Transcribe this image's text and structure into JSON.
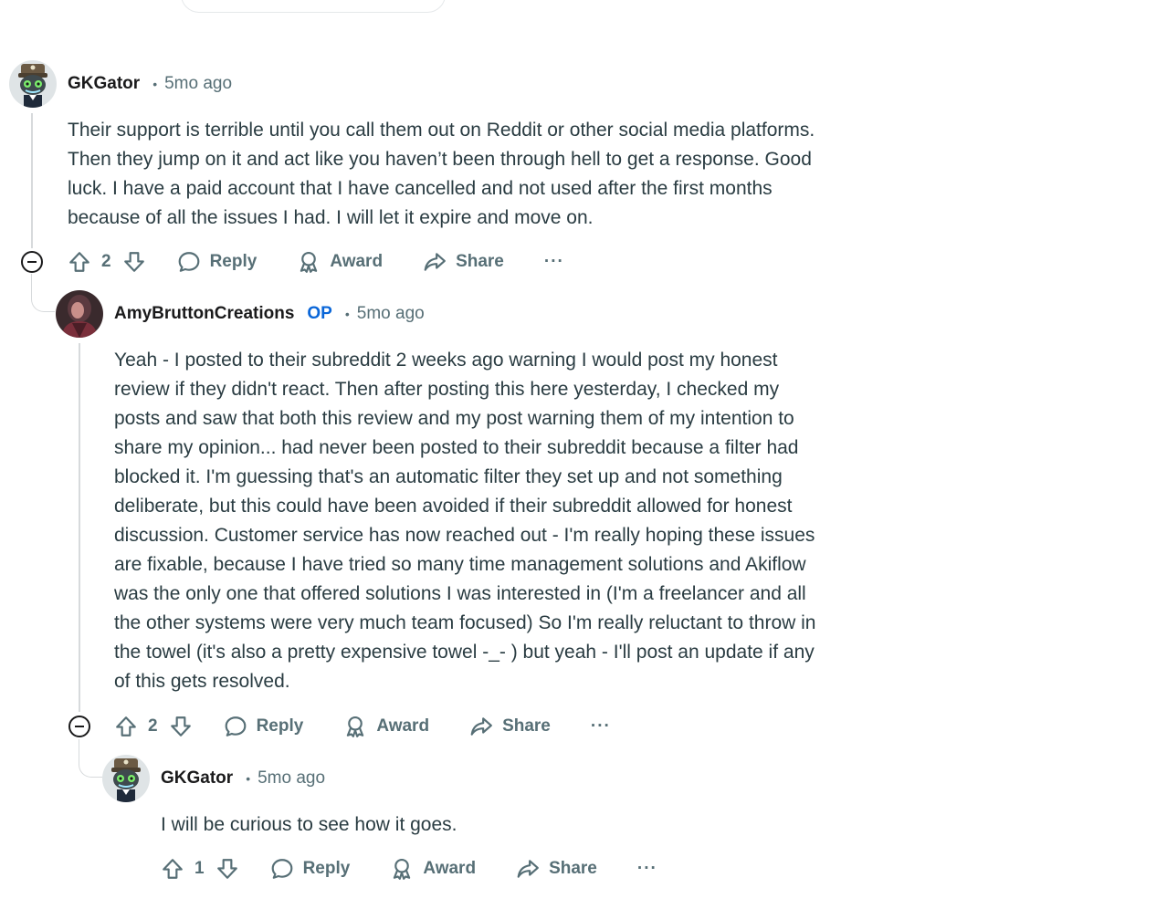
{
  "comments": [
    {
      "author": "GKGator",
      "op": "",
      "separator": "•",
      "time": "5mo ago",
      "body": "Their support is terrible until you call them out on Reddit or other social media platforms.\nThen they jump on it and act like you haven’t been through hell to get a response. Good\nluck. I have a paid account that I have cancelled and not used after the first months\nbecause of all the issues I had. I will let it expire and move on.",
      "votes": "2",
      "reply": "Reply",
      "award": "Award",
      "share": "Share",
      "more": "···"
    },
    {
      "author": "AmyBruttonCreations",
      "op": "OP",
      "separator": "•",
      "time": "5mo ago",
      "body": "Yeah - I posted to their subreddit 2 weeks ago warning I would post my honest\nreview if they didn't react. Then after posting this here yesterday, I checked my\nposts and saw that both this review and my post warning them of my intention to\nshare my opinion... had never been posted to their subreddit because a filter had\nblocked it. I'm guessing that's an automatic filter they set up and not something\ndeliberate, but this could have been avoided if their subreddit allowed for honest\ndiscussion. Customer service has now reached out - I'm really hoping these issues\nare fixable, because I have tried so many time management solutions and Akiflow\nwas the only one that offered solutions I was interested in (I'm a freelancer and all\nthe other systems were very much team focused) So I'm really reluctant to throw in\nthe towel (it's also a pretty expensive towel -_- ) but yeah - I'll post an update if any\nof this gets resolved.",
      "votes": "2",
      "reply": "Reply",
      "award": "Award",
      "share": "Share",
      "more": "···"
    },
    {
      "author": "GKGator",
      "op": "",
      "separator": "•",
      "time": "5mo ago",
      "body": "I will be curious to see how it goes.",
      "votes": "1",
      "reply": "Reply",
      "award": "Award",
      "share": "Share",
      "more": "···"
    }
  ],
  "icons": {
    "upvote": "upvote-arrow-icon",
    "downvote": "downvote-arrow-icon",
    "reply": "speech-bubble-icon",
    "award": "award-ribbon-icon",
    "share": "share-arrow-icon",
    "collapse": "collapse-minus-icon"
  },
  "colors": {
    "op_badge": "#0a66d8",
    "meta_gray": "#576f76",
    "thread_line": "#d7dadc"
  }
}
